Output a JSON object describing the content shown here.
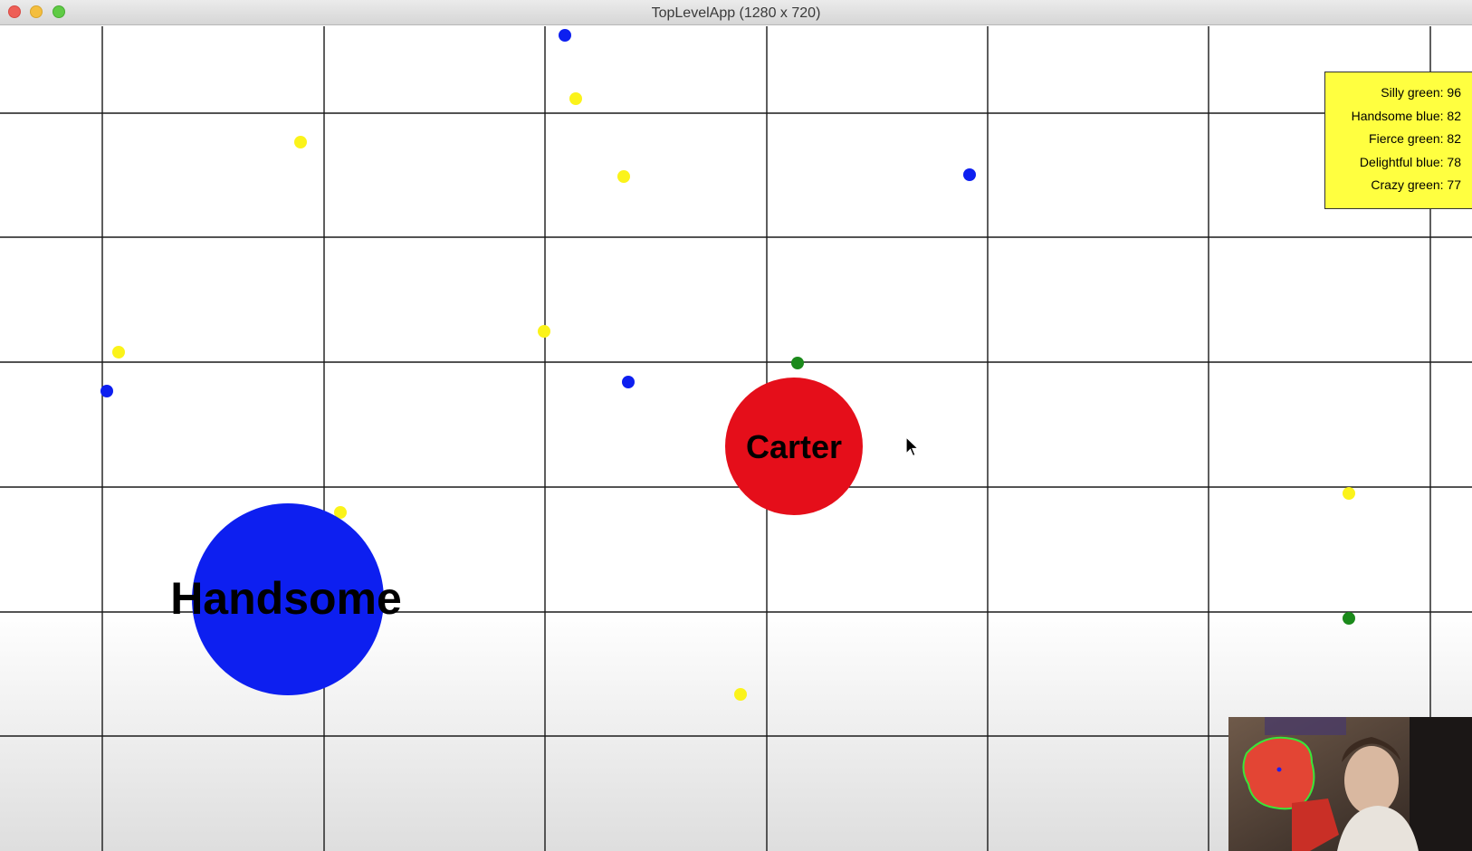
{
  "window": {
    "title": "TopLevelApp (1280 x 720)"
  },
  "colors": {
    "blue": "#0d1ff0",
    "red": "#e50e1a",
    "yellow": "#fbf31a",
    "green": "#1b8a1b",
    "grid": "#1a1a1a",
    "leaderboard_bg": "#ffff40"
  },
  "players": [
    {
      "name": "Handsome",
      "color": "blue"
    },
    {
      "name": "Carter",
      "color": "red"
    }
  ],
  "leaderboard": [
    {
      "label": "Silly green: 96"
    },
    {
      "label": "Handsome blue: 82"
    },
    {
      "label": "Fierce green: 82"
    },
    {
      "label": "Delightful blue: 78"
    },
    {
      "label": "Crazy green: 77"
    }
  ],
  "pellets": {
    "yellow_count": 10,
    "blue_count": 5,
    "green_count": 2
  },
  "webcam": {
    "icon": "webcam-feed"
  },
  "cursor": {
    "icon": "mouse-pointer-icon"
  }
}
